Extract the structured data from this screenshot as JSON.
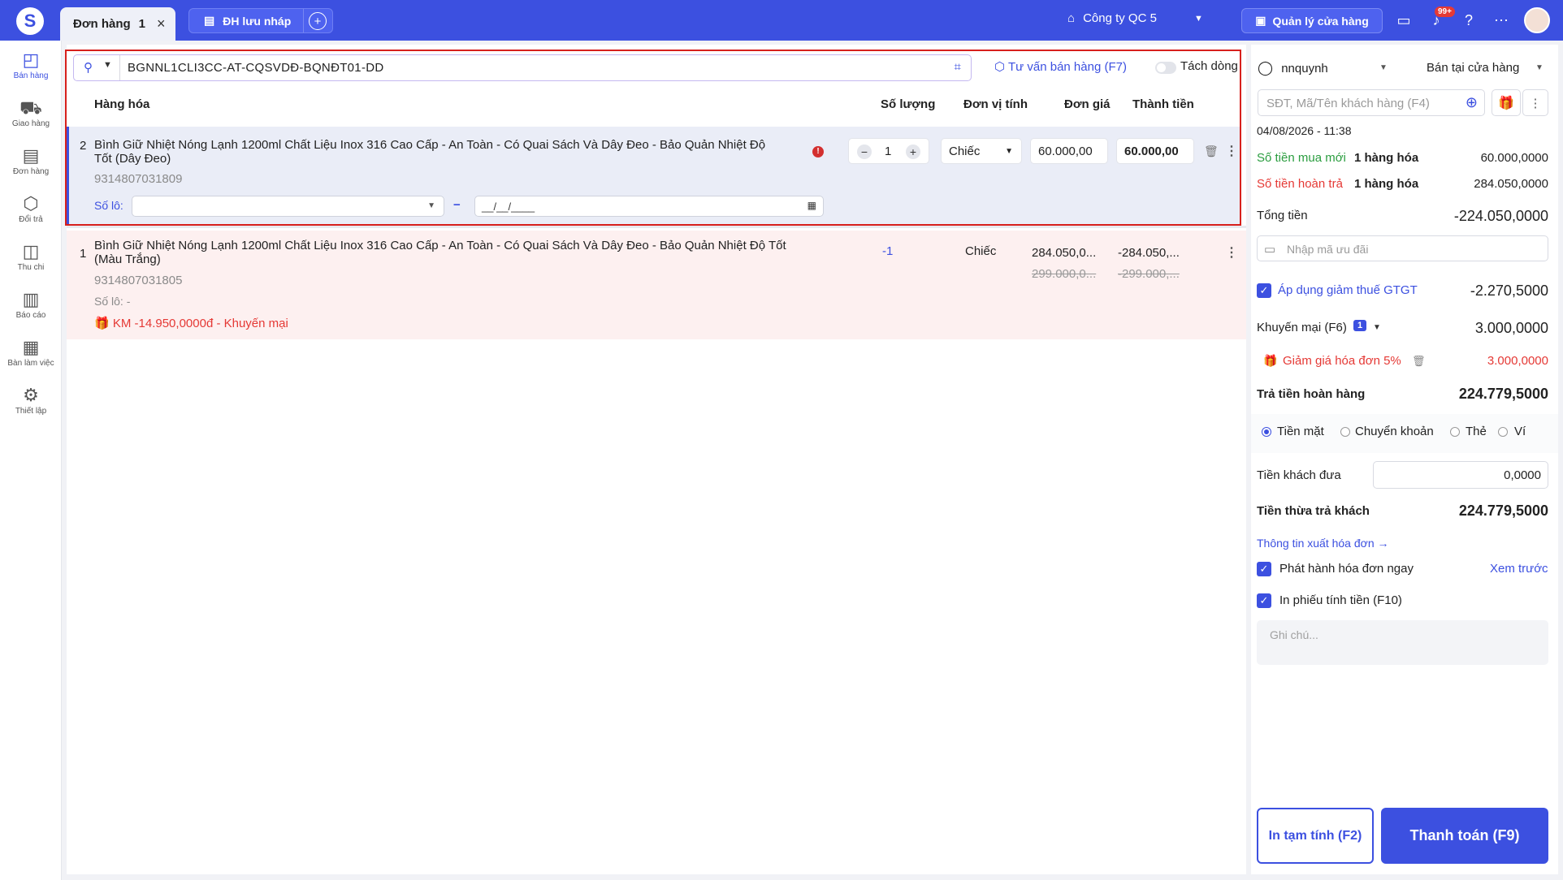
{
  "colors": {
    "primary": "#3c50e0",
    "highlight_border": "#d7201c",
    "return_row_bg": "#fdf0f0",
    "selected_row_bg": "#eaedf7",
    "red": "#e53935",
    "green": "#2a9d3f"
  },
  "topbar": {
    "tab_active_label": "Đơn hàng",
    "tab_active_count": "1",
    "tab_draft_label": "ĐH lưu nháp",
    "company": "Công ty QC 5",
    "store_button": "Quản lý cửa hàng",
    "notification_badge": "99+"
  },
  "sidebar": {
    "items": [
      {
        "label": "Bán hàng",
        "icon": "shopping-bag-icon"
      },
      {
        "label": "Giao hàng",
        "icon": "truck-icon"
      },
      {
        "label": "Đơn hàng",
        "icon": "clipboard-icon"
      },
      {
        "label": "Đổi trả",
        "icon": "box-return-icon"
      },
      {
        "label": "Thu chi",
        "icon": "cash-icon"
      },
      {
        "label": "Báo cáo",
        "icon": "bar-chart-icon"
      },
      {
        "label": "Bàn làm việc",
        "icon": "grid-icon"
      },
      {
        "label": "Thiết lập",
        "icon": "gear-icon"
      }
    ]
  },
  "search": {
    "value": "BGNNL1CLI3CC-AT-CQSVDĐ-BQNĐT01-DD"
  },
  "toolbar": {
    "advise": "Tư vấn bán hàng (F7)",
    "split_lines": "Tách dòng"
  },
  "table": {
    "headers": {
      "product": "Hàng hóa",
      "qty": "Số lượng",
      "unit": "Đơn vị tính",
      "price": "Đơn giá",
      "total": "Thành tiền"
    }
  },
  "row2": {
    "index": "2",
    "name_line1": "Bình Giữ Nhiệt Nóng Lạnh 1200ml Chất Liệu Inox 316 Cao Cấp - An Toàn - Có Quai Sách Và Dây Đeo - Bảo Quản Nhiệt Độ",
    "name_line2": "Tốt (Dây Đeo)",
    "code": "9314807031809",
    "qty": "1",
    "unit": "Chiếc",
    "price": "60.000,00",
    "total": "60.000,00",
    "lot_label": "Số lô:",
    "date_placeholder": "__/__/____"
  },
  "row1": {
    "index": "1",
    "name_line1": "Bình Giữ Nhiệt Nóng Lạnh 1200ml Chất Liệu Inox 316 Cao Cấp - An Toàn - Có Quai Sách Và Dây Đeo - Bảo Quản Nhiệt Độ Tốt",
    "name_line2": "(Màu Trắng)",
    "code": "9314807031805",
    "lot": "Số lô: -",
    "promo": "KM -14.950,0000đ - Khuyến mại",
    "qty": "-1",
    "unit": "Chiếc",
    "price": "284.050,0...",
    "price_old": "299.000,0...",
    "total": "-284.050,...",
    "total_old": "-299.000,..."
  },
  "right": {
    "user": "nnquynh",
    "sale_mode": "Bán tại cửa hàng",
    "customer_placeholder": "SĐT, Mã/Tên khách hàng (F4)",
    "datetime": "04/08/2026 - 11:38",
    "new_purchase_label": "Số tiền mua mới",
    "new_purchase_items": "1 hàng hóa",
    "new_purchase_value": "60.000,0000",
    "refund_label": "Số tiền hoàn trả",
    "refund_items": "1 hàng hóa",
    "refund_value": "284.050,0000",
    "total_label": "Tổng tiền",
    "total_value": "-224.050,0000",
    "voucher_placeholder": "Nhập mã ưu đãi",
    "vat_label": "Áp dụng giảm thuế GTGT",
    "vat_value": "-2.270,5000",
    "promo_label": "Khuyến mại (F6)",
    "promo_count": "1",
    "promo_value": "3.000,0000",
    "discount_label": "Giảm giá hóa đơn 5%",
    "discount_value": "3.000,0000",
    "refund_pay_label": "Trả tiền hoàn hàng",
    "refund_pay_value": "224.779,5000",
    "pay_methods": [
      "Tiền mặt",
      "Chuyển khoản",
      "Thẻ",
      "Ví"
    ],
    "cash_given_label": "Tiền khách đưa",
    "cash_given_value": "0,0000",
    "change_label": "Tiền thừa trả khách",
    "change_value": "224.779,5000",
    "invoice_info": "Thông tin xuất hóa đơn →",
    "issue_invoice": "Phát hành hóa đơn ngay",
    "preview": "Xem trước",
    "print_receipt": "In phiếu tính tiền (F10)",
    "note_placeholder": "Ghi chú...",
    "btn_temp": "In tạm tính (F2)",
    "btn_pay": "Thanh toán (F9)"
  }
}
